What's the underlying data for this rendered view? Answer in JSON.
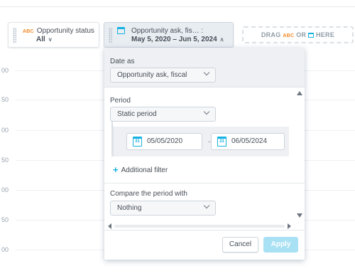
{
  "y_axis_labels": [
    "00",
    "50",
    "00",
    "50",
    "00",
    "50",
    "00"
  ],
  "filter_bar": {
    "status_chip": {
      "type_badge": "ABC",
      "title": "Opportunity status",
      "value": "All",
      "caret": "∨"
    },
    "date_chip": {
      "title": "Opportunity ask, fis… :",
      "value": "May 5, 2020 – Jun 5, 2024",
      "caret": "∧"
    },
    "drop_zone": {
      "drag": "DRAG",
      "abc": "ABC",
      "or": "OR",
      "here": "HERE"
    }
  },
  "overlay": {
    "date_as_label": "Date as",
    "date_as_value": "Opportunity ask, fiscal",
    "period_label": "Period",
    "period_value": "Static period",
    "from_date": "05/05/2020",
    "to_date": "06/05/2024",
    "range_dash": "–",
    "calendar_day": "31",
    "add_filter": "Additional filter",
    "compare_label": "Compare the period with",
    "compare_value": "Nothing",
    "cancel": "Cancel",
    "apply": "Apply"
  },
  "colors": {
    "accent": "#14b2e2",
    "abc_badge": "#f38a25",
    "apply_disabled": "#a9e1f4"
  }
}
